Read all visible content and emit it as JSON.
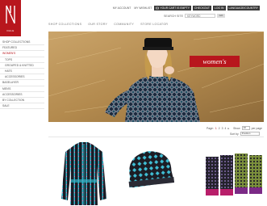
{
  "header": {
    "logo_text": "DALE",
    "utility_links": [
      "MY ACCOUNT",
      "MY WISHLIST"
    ],
    "utility_buttons": [
      "YOUR CART IS EMPTY",
      "CHECKOUT",
      "LOG IN",
      "LANGUAGE/COUNTRY"
    ],
    "search_label": "SEARCH SITE",
    "search_placeholder": "KEYWORD",
    "search_button": "GO"
  },
  "mainnav": [
    "SHOP COLLECTIONS",
    "OUR STORY",
    "COMMUNITY",
    "STORE LOCATOR"
  ],
  "sidebar": [
    {
      "label": "SHOP COLLECTIONS",
      "sub": false,
      "active": false
    },
    {
      "label": "FEATURED",
      "sub": false,
      "active": false
    },
    {
      "label": "WOMEN'S",
      "sub": false,
      "active": true
    },
    {
      "label": "TOPS",
      "sub": true,
      "active": false
    },
    {
      "label": "GROUPED & KNITTED",
      "sub": true,
      "active": false
    },
    {
      "label": "HATS",
      "sub": true,
      "active": false
    },
    {
      "label": "ACCESSORIES",
      "sub": true,
      "active": false
    },
    {
      "label": "BASELAYER",
      "sub": false,
      "active": false
    },
    {
      "label": "MEN'S",
      "sub": false,
      "active": false
    },
    {
      "label": "ACCESSORIES",
      "sub": false,
      "active": false
    },
    {
      "label": "BY COLLECTION",
      "sub": false,
      "active": false
    },
    {
      "label": "SALE",
      "sub": false,
      "active": false
    }
  ],
  "hero": {
    "banner": "women's"
  },
  "pager": {
    "pages_label": "Page:",
    "pages": [
      "1",
      "2",
      "3",
      "4"
    ],
    "current_page": "1",
    "show_label": "Show",
    "show_value": "20",
    "per_page_label": "per page",
    "sort_label": "Sort by",
    "sort_value": "Position"
  },
  "colors": {
    "brand_red": "#b8161d",
    "knit_dark": "#1c2a3e",
    "knit_accent": "#2fb5c9"
  },
  "icons": [
    "dale-logo-icon",
    "cart-icon",
    "next-arrow-icon"
  ]
}
